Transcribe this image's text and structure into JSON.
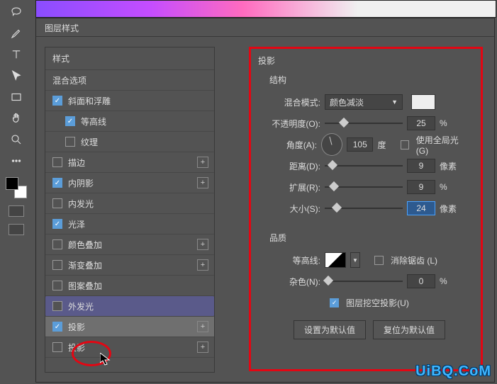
{
  "dialog_title": "图层样式",
  "left": {
    "styles_header": "样式",
    "blending_options": "混合选项",
    "items": [
      {
        "label": "斜面和浮雕",
        "checked": true,
        "plus": false,
        "sub": false
      },
      {
        "label": "等高线",
        "checked": true,
        "plus": false,
        "sub": true
      },
      {
        "label": "纹理",
        "checked": false,
        "plus": false,
        "sub": true
      },
      {
        "label": "描边",
        "checked": false,
        "plus": true,
        "sub": false
      },
      {
        "label": "内阴影",
        "checked": true,
        "plus": true,
        "sub": false
      },
      {
        "label": "内发光",
        "checked": false,
        "plus": false,
        "sub": false
      },
      {
        "label": "光泽",
        "checked": true,
        "plus": false,
        "sub": false
      },
      {
        "label": "颜色叠加",
        "checked": false,
        "plus": true,
        "sub": false
      },
      {
        "label": "渐变叠加",
        "checked": false,
        "plus": true,
        "sub": false
      },
      {
        "label": "图案叠加",
        "checked": false,
        "plus": false,
        "sub": false
      },
      {
        "label": "外发光",
        "checked": false,
        "plus": false,
        "sub": false,
        "highlighted": true
      },
      {
        "label": "投影",
        "checked": true,
        "plus": true,
        "sub": false,
        "selected": true,
        "circled": true
      },
      {
        "label": "投影",
        "checked": false,
        "plus": true,
        "sub": false
      }
    ]
  },
  "right": {
    "section_title": "投影",
    "structure_label": "结构",
    "blend_mode_label": "混合模式:",
    "blend_mode_value": "颜色减淡",
    "opacity_label": "不透明度(O):",
    "opacity_value": "25",
    "opacity_unit": "%",
    "angle_label": "角度(A):",
    "angle_value": "105",
    "angle_unit": "度",
    "global_light_label": "使用全局光 (G)",
    "global_light_checked": false,
    "distance_label": "距离(D):",
    "distance_value": "9",
    "distance_unit": "像素",
    "spread_label": "扩展(R):",
    "spread_value": "9",
    "spread_unit": "%",
    "size_label": "大小(S):",
    "size_value": "24",
    "size_unit": "像素",
    "quality_label": "品质",
    "contour_label": "等高线:",
    "antialias_label": "消除锯齿 (L)",
    "antialias_checked": false,
    "noise_label": "杂色(N):",
    "noise_value": "0",
    "noise_unit": "%",
    "knockout_label": "图层挖空投影(U)",
    "knockout_checked": true,
    "btn_default": "设置为默认值",
    "btn_reset": "复位为默认值"
  },
  "watermark": "UiBQ.CoM"
}
